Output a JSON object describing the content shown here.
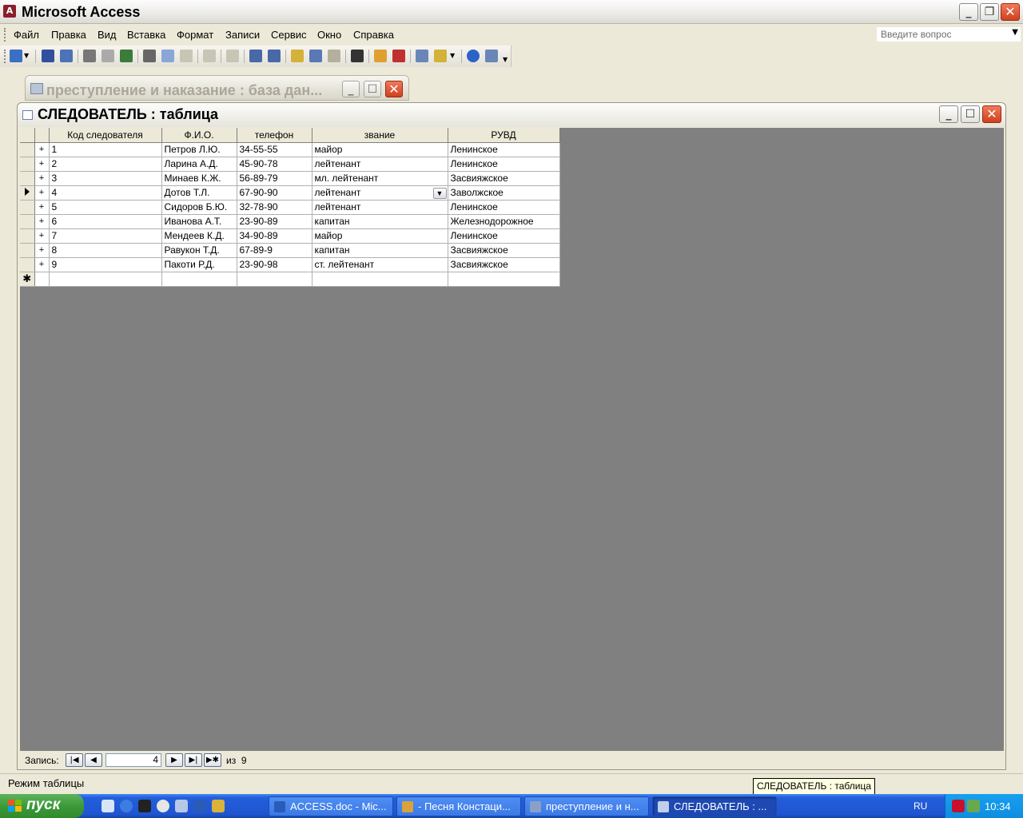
{
  "app": {
    "title": "Microsoft Access",
    "icon_letter": "A"
  },
  "menu": {
    "items": [
      "Файл",
      "Правка",
      "Вид",
      "Вставка",
      "Формат",
      "Записи",
      "Сервис",
      "Окно",
      "Справка"
    ],
    "ask_placeholder": "Введите вопрос"
  },
  "toolbar": {
    "icons": [
      "view-icon",
      "save-icon",
      "search-icon",
      "print-icon",
      "print-preview-icon",
      "spelling-icon",
      "cut-icon",
      "copy-icon",
      "paste-icon",
      "undo-icon",
      "hyperlink-icon",
      "sort-ascending-icon",
      "sort-descending-icon",
      "filter-by-selection-icon",
      "filter-by-form-icon",
      "apply-filter-icon",
      "find-icon",
      "new-record-icon",
      "delete-record-icon",
      "database-window-icon",
      "new-object-icon",
      "help-icon",
      "relationships-icon"
    ]
  },
  "db_window": {
    "title": "преступление и наказание : база дан..."
  },
  "table_window": {
    "title": "СЛЕДОВАТЕЛЬ : таблица",
    "columns": [
      "Код следователя",
      "Ф.И.О.",
      "телефон",
      "звание",
      "РУВД"
    ],
    "rows": [
      [
        "1",
        "Петров Л.Ю.",
        "34-55-55",
        "майор",
        "Ленинское"
      ],
      [
        "2",
        "Ларина А.Д.",
        "45-90-78",
        "лейтенант",
        "Ленинское"
      ],
      [
        "3",
        "Минаев К.Ж.",
        "56-89-79",
        "мл. лейтенант",
        "Засвияжское"
      ],
      [
        "4",
        "Дотов Т.Л.",
        "67-90-90",
        "лейтенант",
        "Заволжское"
      ],
      [
        "5",
        "Сидоров Б.Ю.",
        "32-78-90",
        "лейтенант",
        "Ленинское"
      ],
      [
        "6",
        "Иванова А.Т.",
        "23-90-89",
        "капитан",
        "Железнодорожное"
      ],
      [
        "7",
        "Мендеев К.Д.",
        "34-90-89",
        "майор",
        "Ленинское"
      ],
      [
        "8",
        "Равукон Т.Д.",
        "67-89-9",
        "капитан",
        "Засвияжское"
      ],
      [
        "9",
        "Пакоти Р.Д.",
        "23-90-98",
        "ст. лейтенант",
        "Засвияжское"
      ]
    ],
    "current_row_index": 3,
    "expand_symbol": "+",
    "new_row_symbol": "✱"
  },
  "nav": {
    "label": "Запись:",
    "current": "4",
    "of_label": "из",
    "total": "9"
  },
  "status": {
    "text": "Режим таблицы",
    "tooltip": "СЛЕДОВАТЕЛЬ : таблица"
  },
  "taskbar": {
    "start": "пуск",
    "tasks": [
      {
        "label": "ACCESS.doc - Mic...",
        "icon_color": "#2b5bb8"
      },
      {
        "label": "- Песня Констаци...",
        "icon_color": "#d9a23a"
      },
      {
        "label": "преступление и н...",
        "icon_color": "#8aa0c8"
      },
      {
        "label": "СЛЕДОВАТЕЛЬ : ...",
        "icon_color": "#c0d0e8"
      }
    ],
    "lang": "RU",
    "clock": "10:34"
  }
}
